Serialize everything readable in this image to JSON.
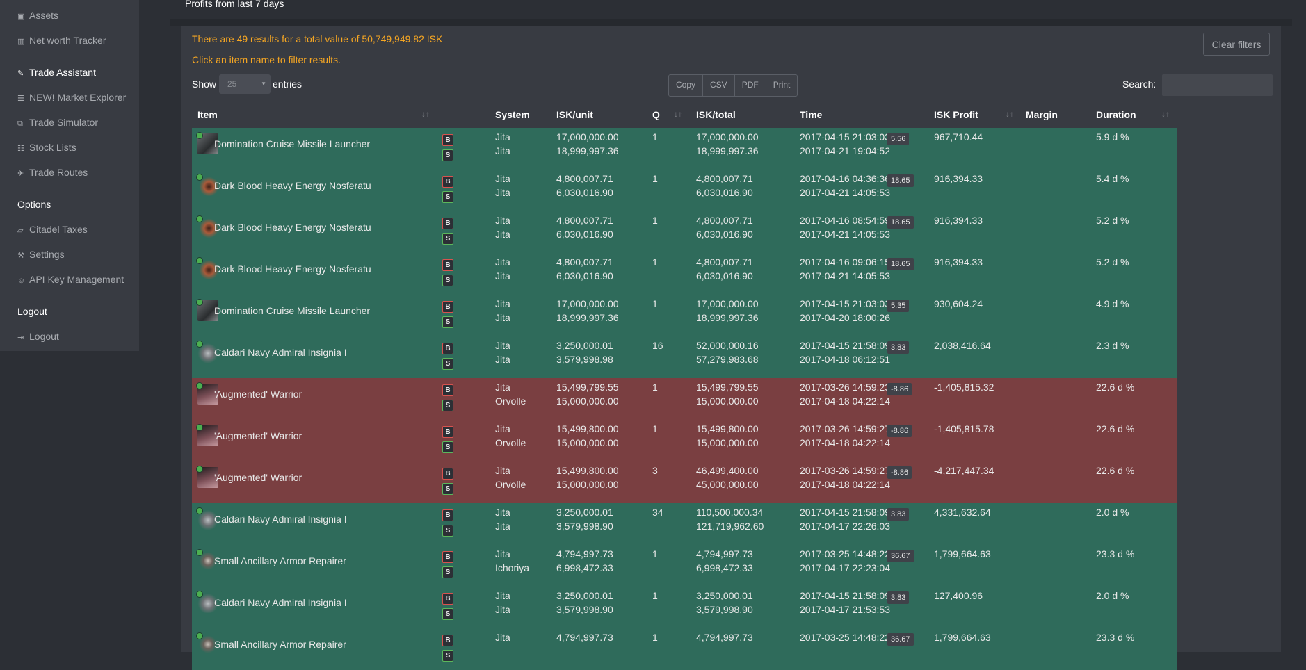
{
  "sidebar": {
    "items": [
      {
        "label": "Assets",
        "icon": "briefcase-icon",
        "glyph": "▣"
      },
      {
        "label": "Net worth Tracker",
        "icon": "bar-chart-icon",
        "glyph": "▥"
      },
      {
        "label": "Trade Assistant",
        "icon": "pencil-icon",
        "glyph": "✎"
      },
      {
        "label": "NEW! Market Explorer",
        "icon": "database-icon",
        "glyph": "☰"
      },
      {
        "label": "Trade Simulator",
        "icon": "copy-icon",
        "glyph": "⧉"
      },
      {
        "label": "Stock Lists",
        "icon": "list-icon",
        "glyph": "☷"
      },
      {
        "label": "Trade Routes",
        "icon": "plane-icon",
        "glyph": "✈"
      }
    ],
    "options_heading": "Options",
    "options": [
      {
        "label": "Citadel Taxes",
        "icon": "eraser-icon",
        "glyph": "▱"
      },
      {
        "label": "Settings",
        "icon": "wrench-icon",
        "glyph": "⚒"
      },
      {
        "label": "API Key Management",
        "icon": "users-icon",
        "glyph": "☺"
      }
    ],
    "logout_heading": "Logout",
    "logout": {
      "label": "Logout",
      "icon": "sign-out-icon",
      "glyph": "⇥"
    }
  },
  "panel": {
    "title": "Profits from last 7 days",
    "results_text": "There are 49 results for a total value of 50,749,949.82 ISK",
    "hint_text": "Click an item name to filter results.",
    "clear_filters": "Clear filters",
    "show_label": "Show",
    "entries_value": "25",
    "entries_label": "entries",
    "buttons": [
      "Copy",
      "CSV",
      "PDF",
      "Print"
    ],
    "search_label": "Search:",
    "search_value": ""
  },
  "table": {
    "headers": {
      "item": "Item",
      "system": "System",
      "isk_unit": "ISK/unit",
      "q": "Q",
      "isk_total": "ISK/total",
      "time": "Time",
      "isk_profit": "ISK Profit",
      "margin": "Margin",
      "duration": "Duration"
    },
    "buy_badge": "B",
    "sell_badge": "S",
    "rows": [
      {
        "status": "pos",
        "icon": "ic-launcher",
        "name": "Domination Cruise Missile Launcher",
        "sys1": "Jita",
        "sys2": "Jita",
        "unit1": "17,000,000.00",
        "unit2": "18,999,997.36",
        "q": "1",
        "tot1": "17,000,000.00",
        "tot2": "18,999,997.36",
        "t1": "2017-04-15 21:03:03",
        "t2": "2017-04-21 19:04:52",
        "profit": "967,710.44",
        "margin": "5.56",
        "duration": "5.9 d %"
      },
      {
        "status": "pos",
        "icon": "ic-nos",
        "name": "Dark Blood Heavy Energy Nosferatu",
        "sys1": "Jita",
        "sys2": "Jita",
        "unit1": "4,800,007.71",
        "unit2": "6,030,016.90",
        "q": "1",
        "tot1": "4,800,007.71",
        "tot2": "6,030,016.90",
        "t1": "2017-04-16 04:36:36",
        "t2": "2017-04-21 14:05:53",
        "profit": "916,394.33",
        "margin": "18.65",
        "duration": "5.4 d %"
      },
      {
        "status": "pos",
        "icon": "ic-nos",
        "name": "Dark Blood Heavy Energy Nosferatu",
        "sys1": "Jita",
        "sys2": "Jita",
        "unit1": "4,800,007.71",
        "unit2": "6,030,016.90",
        "q": "1",
        "tot1": "4,800,007.71",
        "tot2": "6,030,016.90",
        "t1": "2017-04-16 08:54:59",
        "t2": "2017-04-21 14:05:53",
        "profit": "916,394.33",
        "margin": "18.65",
        "duration": "5.2 d %"
      },
      {
        "status": "pos",
        "icon": "ic-nos",
        "name": "Dark Blood Heavy Energy Nosferatu",
        "sys1": "Jita",
        "sys2": "Jita",
        "unit1": "4,800,007.71",
        "unit2": "6,030,016.90",
        "q": "1",
        "tot1": "4,800,007.71",
        "tot2": "6,030,016.90",
        "t1": "2017-04-16 09:06:15",
        "t2": "2017-04-21 14:05:53",
        "profit": "916,394.33",
        "margin": "18.65",
        "duration": "5.2 d %"
      },
      {
        "status": "pos",
        "icon": "ic-launcher",
        "name": "Domination Cruise Missile Launcher",
        "sys1": "Jita",
        "sys2": "Jita",
        "unit1": "17,000,000.00",
        "unit2": "18,999,997.36",
        "q": "1",
        "tot1": "17,000,000.00",
        "tot2": "18,999,997.36",
        "t1": "2017-04-15 21:03:03",
        "t2": "2017-04-20 18:00:26",
        "profit": "930,604.24",
        "margin": "5.35",
        "duration": "4.9 d %"
      },
      {
        "status": "pos",
        "icon": "ic-insignia",
        "name": "Caldari Navy Admiral Insignia I",
        "sys1": "Jita",
        "sys2": "Jita",
        "unit1": "3,250,000.01",
        "unit2": "3,579,998.98",
        "q": "16",
        "tot1": "52,000,000.16",
        "tot2": "57,279,983.68",
        "t1": "2017-04-15 21:58:09",
        "t2": "2017-04-18 06:12:51",
        "profit": "2,038,416.64",
        "margin": "3.83",
        "duration": "2.3 d %"
      },
      {
        "status": "neg",
        "icon": "ic-warrior",
        "name": "'Augmented' Warrior",
        "sys1": "Jita",
        "sys2": "Orvolle",
        "unit1": "15,499,799.55",
        "unit2": "15,000,000.00",
        "q": "1",
        "tot1": "15,499,799.55",
        "tot2": "15,000,000.00",
        "t1": "2017-03-26 14:59:23",
        "t2": "2017-04-18 04:22:14",
        "profit": "-1,405,815.32",
        "margin": "-8.86",
        "duration": "22.6 d %"
      },
      {
        "status": "neg",
        "icon": "ic-warrior",
        "name": "'Augmented' Warrior",
        "sys1": "Jita",
        "sys2": "Orvolle",
        "unit1": "15,499,800.00",
        "unit2": "15,000,000.00",
        "q": "1",
        "tot1": "15,499,800.00",
        "tot2": "15,000,000.00",
        "t1": "2017-03-26 14:59:27",
        "t2": "2017-04-18 04:22:14",
        "profit": "-1,405,815.78",
        "margin": "-8.86",
        "duration": "22.6 d %"
      },
      {
        "status": "neg",
        "icon": "ic-warrior",
        "name": "'Augmented' Warrior",
        "sys1": "Jita",
        "sys2": "Orvolle",
        "unit1": "15,499,800.00",
        "unit2": "15,000,000.00",
        "q": "3",
        "tot1": "46,499,400.00",
        "tot2": "45,000,000.00",
        "t1": "2017-03-26 14:59:27",
        "t2": "2017-04-18 04:22:14",
        "profit": "-4,217,447.34",
        "margin": "-8.86",
        "duration": "22.6 d %"
      },
      {
        "status": "pos",
        "icon": "ic-insignia",
        "name": "Caldari Navy Admiral Insignia I",
        "sys1": "Jita",
        "sys2": "Jita",
        "unit1": "3,250,000.01",
        "unit2": "3,579,998.90",
        "q": "34",
        "tot1": "110,500,000.34",
        "tot2": "121,719,962.60",
        "t1": "2017-04-15 21:58:09",
        "t2": "2017-04-17 22:26:03",
        "profit": "4,331,632.64",
        "margin": "3.83",
        "duration": "2.0 d %"
      },
      {
        "status": "pos",
        "icon": "ic-repair",
        "name": "Small Ancillary Armor Repairer",
        "sys1": "Jita",
        "sys2": "Ichoriya",
        "unit1": "4,794,997.73",
        "unit2": "6,998,472.33",
        "q": "1",
        "tot1": "4,794,997.73",
        "tot2": "6,998,472.33",
        "t1": "2017-03-25 14:48:22",
        "t2": "2017-04-17 22:23:04",
        "profit": "1,799,664.63",
        "margin": "36.67",
        "duration": "23.3 d %"
      },
      {
        "status": "pos",
        "icon": "ic-insignia",
        "name": "Caldari Navy Admiral Insignia I",
        "sys1": "Jita",
        "sys2": "Jita",
        "unit1": "3,250,000.01",
        "unit2": "3,579,998.90",
        "q": "1",
        "tot1": "3,250,000.01",
        "tot2": "3,579,998.90",
        "t1": "2017-04-15 21:58:09",
        "t2": "2017-04-17 21:53:53",
        "profit": "127,400.96",
        "margin": "3.83",
        "duration": "2.0 d %"
      },
      {
        "status": "pos",
        "icon": "ic-repair",
        "name": "Small Ancillary Armor Repairer",
        "sys1": "Jita",
        "sys2": "",
        "unit1": "4,794,997.73",
        "unit2": "",
        "q": "1",
        "tot1": "4,794,997.73",
        "tot2": "",
        "t1": "2017-03-25 14:48:22",
        "t2": "",
        "profit": "1,799,664.63",
        "margin": "36.67",
        "duration": "23.3 d %"
      }
    ]
  }
}
